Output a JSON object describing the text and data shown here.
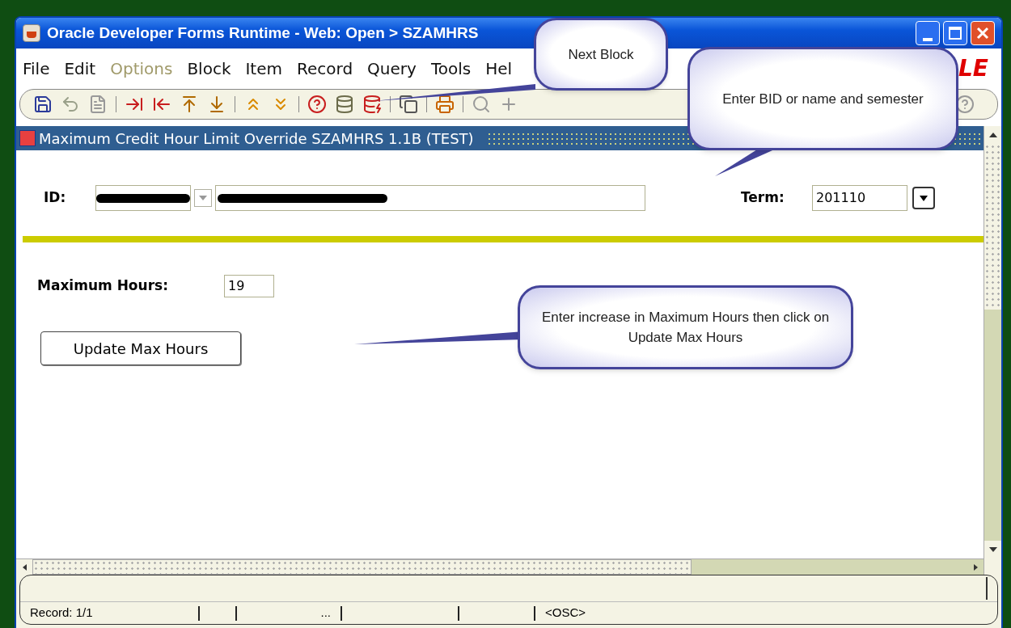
{
  "window": {
    "title": "Oracle Developer Forms Runtime - Web:  Open > SZAMHRS"
  },
  "menu": [
    {
      "label": "File",
      "disabled": false
    },
    {
      "label": "Edit",
      "disabled": false
    },
    {
      "label": "Options",
      "disabled": true
    },
    {
      "label": "Block",
      "disabled": false
    },
    {
      "label": "Item",
      "disabled": false
    },
    {
      "label": "Record",
      "disabled": false
    },
    {
      "label": "Query",
      "disabled": false
    },
    {
      "label": "Tools",
      "disabled": false
    },
    {
      "label": "Hel",
      "disabled": false
    }
  ],
  "logo": "LE",
  "form": {
    "title": "Maximum Credit Hour Limit Override  SZAMHRS  1.1B  (TEST)",
    "id_label": "ID:",
    "term_label": "Term:",
    "term_value": "201110",
    "max_hours_label": "Maximum Hours:",
    "max_hours_value": "19",
    "button": "Update Max Hours"
  },
  "callouts": [
    {
      "text": "Next Block"
    },
    {
      "text": "Enter BID or name and semester"
    },
    {
      "text": "Enter increase in Maximum Hours then click on Update Max Hours"
    }
  ],
  "status_bar": {
    "record": "Record: 1/1",
    "ellipsis": "...",
    "mode": "<OSC>"
  }
}
